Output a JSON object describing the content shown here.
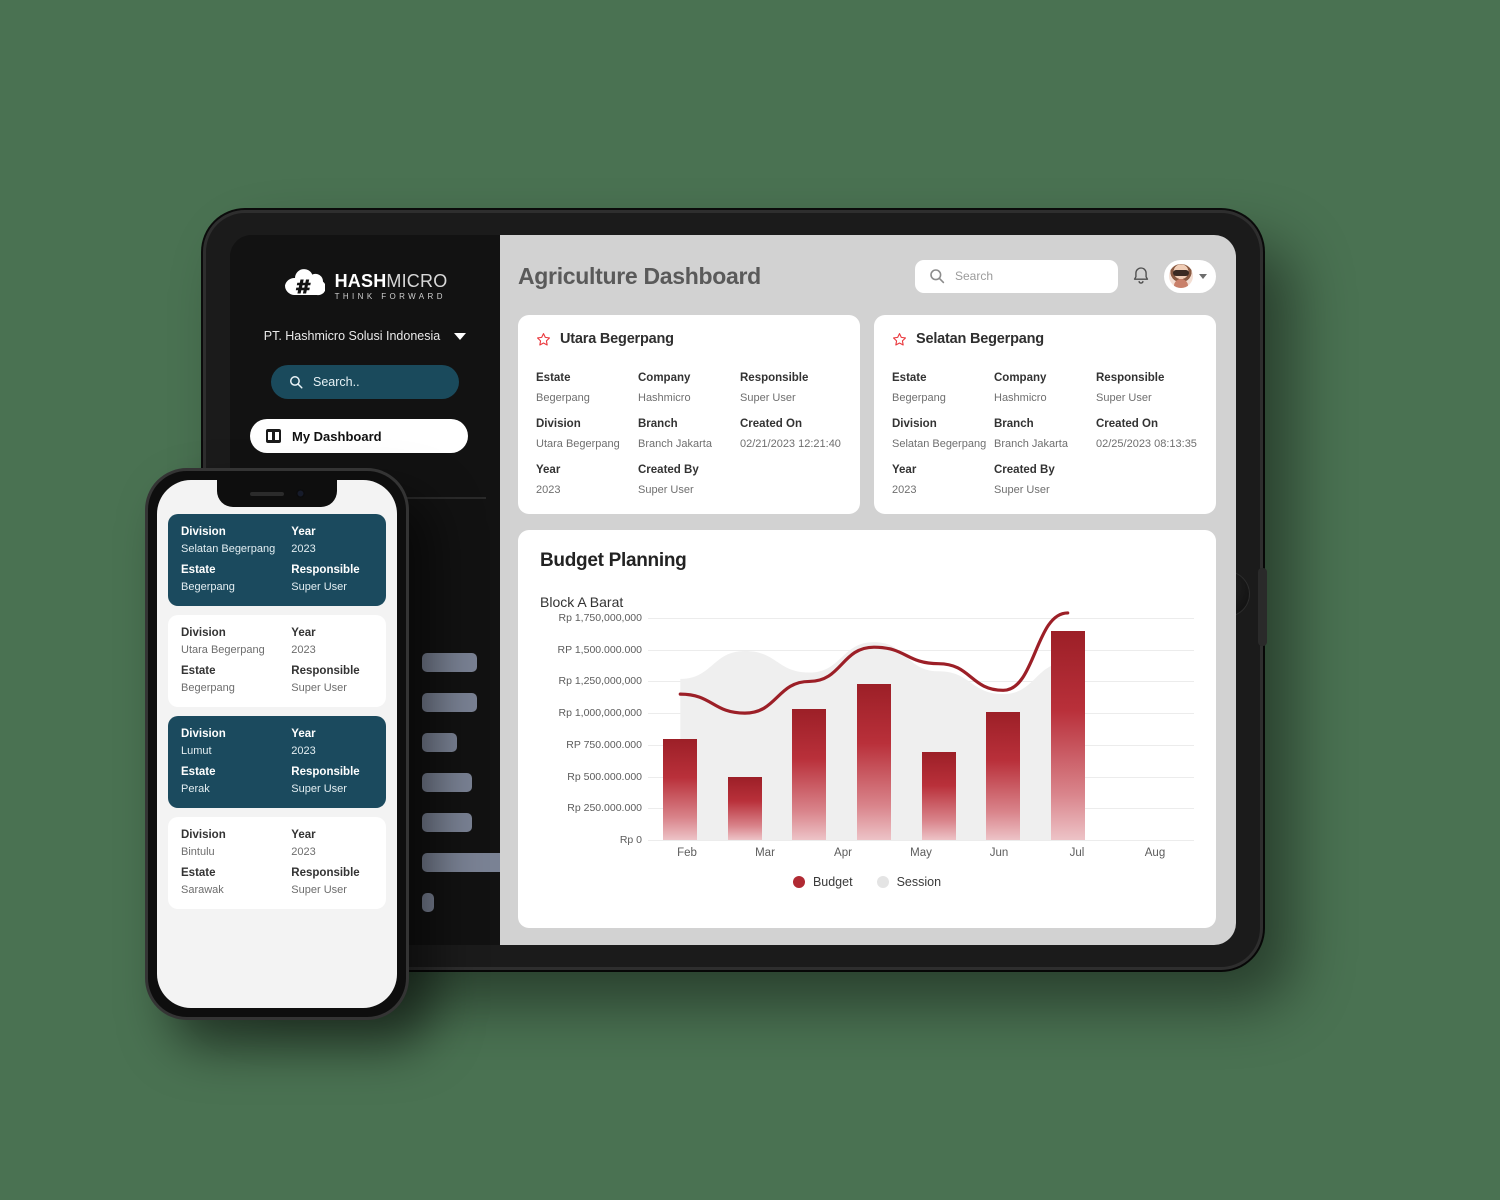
{
  "background_color": "#4a7252",
  "brand": {
    "logo_name": "hashmicro-logo",
    "logo_text_bold": "HASH",
    "logo_text_light": "MICRO",
    "logo_tagline": "THINK FORWARD"
  },
  "sidebar": {
    "company_selector": "PT. Hashmicro Solusi Indonesia",
    "search_placeholder": "Search..",
    "active_nav_label": "My Dashboard",
    "skeleton_widths": [
      55,
      55,
      35,
      50,
      50,
      88,
      12
    ]
  },
  "header": {
    "title": "Agriculture Dashboard",
    "search_placeholder": "Search",
    "notification_icon": "bell-icon",
    "avatar_icon": "user-avatar"
  },
  "info_cards": [
    {
      "title": "Utara Begerpang",
      "fields": [
        {
          "label": "Estate",
          "value": "Begerpang"
        },
        {
          "label": "Company",
          "value": "Hashmicro"
        },
        {
          "label": "Responsible",
          "value": "Super User"
        },
        {
          "label": "Division",
          "value": "Utara Begerpang"
        },
        {
          "label": "Branch",
          "value": "Branch Jakarta"
        },
        {
          "label": "Created On",
          "value": "02/21/2023 12:21:40"
        },
        {
          "label": "Year",
          "value": "2023"
        },
        {
          "label": "Created By",
          "value": "Super User"
        },
        {
          "label": "",
          "value": ""
        }
      ]
    },
    {
      "title": "Selatan Begerpang",
      "fields": [
        {
          "label": "Estate",
          "value": "Begerpang"
        },
        {
          "label": "Company",
          "value": "Hashmicro"
        },
        {
          "label": "Responsible",
          "value": "Super User"
        },
        {
          "label": "Division",
          "value": "Selatan Begerpang"
        },
        {
          "label": "Branch",
          "value": "Branch Jakarta"
        },
        {
          "label": "Created On",
          "value": "02/25/2023 08:13:35"
        },
        {
          "label": "Year",
          "value": "2023"
        },
        {
          "label": "Created By",
          "value": "Super User"
        },
        {
          "label": "",
          "value": ""
        }
      ]
    }
  ],
  "budget_panel": {
    "title": "Budget Planning",
    "subtitle": "Block A Barat"
  },
  "chart_data": {
    "type": "bar",
    "title": "Budget Planning",
    "subtitle": "Block A Barat",
    "xlabel": "",
    "ylabel": "",
    "ylim": [
      0,
      1750000000
    ],
    "grid": true,
    "legend_position": "bottom",
    "categories": [
      "Feb",
      "Mar",
      "Apr",
      "May",
      "Jun",
      "Jul",
      "Aug"
    ],
    "ytick_labels": [
      "Rp 1,750,000,000",
      "RP 1,500.000.000",
      "Rp 1,250,000,000",
      "Rp 1,000,000,000",
      "RP 750.000.000",
      "Rp 500.000.000",
      "Rp 250.000.000",
      "Rp 0"
    ],
    "ytick_values": [
      1750000000,
      1500000000,
      1250000000,
      1000000000,
      750000000,
      500000000,
      250000000,
      0
    ],
    "series": [
      {
        "name": "Budget",
        "type": "bar",
        "color": "#b02a33",
        "values": [
          800000000,
          500000000,
          1030000000,
          1230000000,
          690000000,
          1010000000,
          1650000000
        ]
      },
      {
        "name": "Session",
        "type": "area",
        "color": "#efefef",
        "values": [
          1270000000,
          1490000000,
          1320000000,
          1560000000,
          1330000000,
          1150000000,
          1400000000
        ]
      }
    ],
    "trend_line": {
      "name": "Budget trend",
      "color": "#9c1f27",
      "values": [
        1150000000,
        1000000000,
        1250000000,
        1520000000,
        1390000000,
        1180000000,
        1790000000
      ]
    },
    "legend": [
      {
        "label": "Budget",
        "color": "#b02a33"
      },
      {
        "label": "Session",
        "color": "#e4e4e4"
      }
    ]
  },
  "phone_cards": [
    {
      "theme": "dark",
      "fields": [
        {
          "label": "Division",
          "value": "Selatan Begerpang"
        },
        {
          "label": "Year",
          "value": "2023"
        },
        {
          "label": "Estate",
          "value": "Begerpang"
        },
        {
          "label": "Responsible",
          "value": "Super User"
        }
      ]
    },
    {
      "theme": "light",
      "fields": [
        {
          "label": "Division",
          "value": "Utara Begerpang"
        },
        {
          "label": "Year",
          "value": "2023"
        },
        {
          "label": "Estate",
          "value": "Begerpang"
        },
        {
          "label": "Responsible",
          "value": "Super User"
        }
      ]
    },
    {
      "theme": "dark",
      "fields": [
        {
          "label": "Division",
          "value": "Lumut"
        },
        {
          "label": "Year",
          "value": "2023"
        },
        {
          "label": "Estate",
          "value": "Perak"
        },
        {
          "label": "Responsible",
          "value": "Super User"
        }
      ]
    },
    {
      "theme": "light",
      "fields": [
        {
          "label": "Division",
          "value": "Bintulu"
        },
        {
          "label": "Year",
          "value": "2023"
        },
        {
          "label": "Estate",
          "value": "Sarawak"
        },
        {
          "label": "Responsible",
          "value": "Super User"
        }
      ]
    }
  ]
}
